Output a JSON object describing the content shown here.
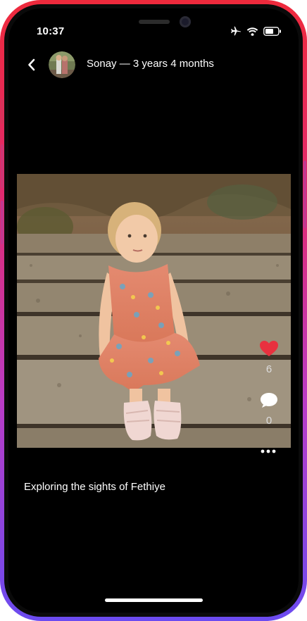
{
  "status_bar": {
    "time": "10:37",
    "icons": [
      "airplane-icon",
      "wifi-icon",
      "battery-icon"
    ]
  },
  "nav": {
    "back_icon": "chevron-left-icon",
    "title": "Sonay — 3 years 4 months"
  },
  "post": {
    "likes": "6",
    "comments": "0",
    "caption": "Exploring the sights of Fethiye",
    "like_icon": "heart-icon",
    "comment_icon": "speech-bubble-icon",
    "more_icon": "ellipsis-icon"
  },
  "colors": {
    "frame_top": "#ee2a3c",
    "frame_bottom": "#6b4bf0",
    "like_red": "#e8313f"
  }
}
